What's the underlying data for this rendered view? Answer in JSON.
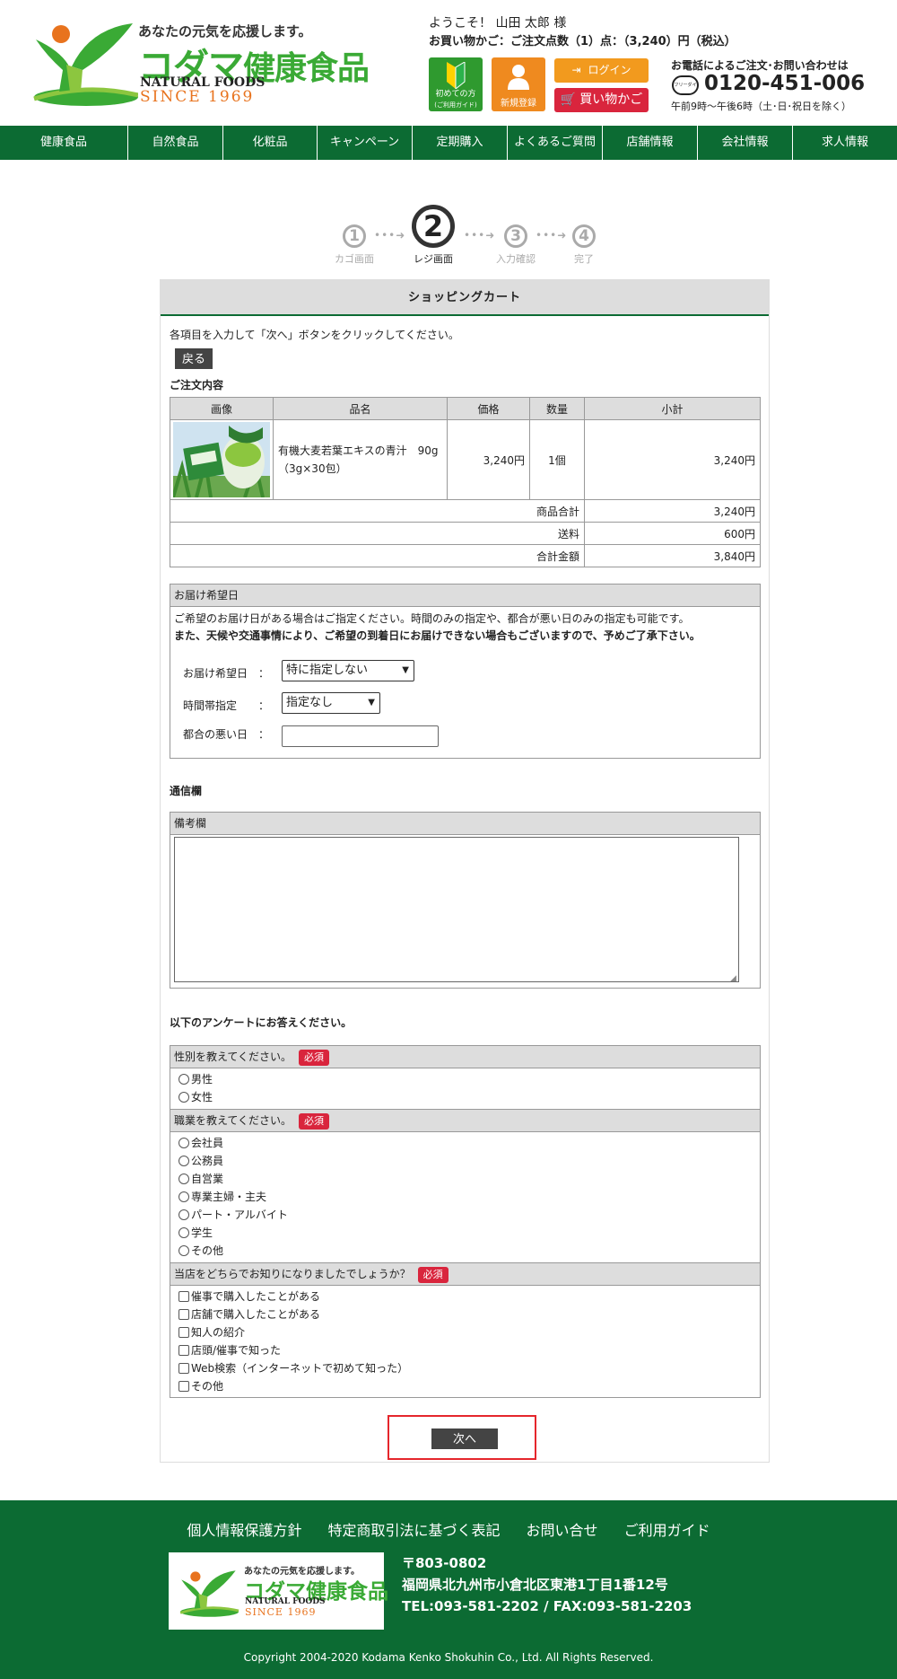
{
  "header": {
    "tagline": "あなたの元気を応援します。",
    "brand_kodama": "コダマ",
    "brand_kenko": "健康食品",
    "natural_foods": "NATURAL FOODS",
    "since": "SINCE  1969",
    "welcome": "ようこそ！ 山田 太郎 様",
    "cart_summary": "お買い物かご：ご注文点数（1）点：（3,240）円（税込）",
    "btn_first": "初めての方",
    "btn_first_sub": "(ご利用ガイド)",
    "btn_register": "新規登録",
    "btn_login": "ログイン",
    "btn_cart": "買い物かご",
    "tel_label": "お電話によるご注文･お問い合わせは",
    "tel_icon_text": "フリーダイヤル",
    "tel_number": "0120-451-006",
    "tel_hours": "午前9時〜午後6時（土･日･祝日を除く）",
    "colors": {
      "brand_green": "#3aaa35",
      "nav_green": "#0c6b33",
      "orange": "#ef8a1f",
      "red": "#d9253d"
    }
  },
  "nav": [
    "健康食品",
    "自然食品",
    "化粧品",
    "キャンペーン",
    "定期購入",
    "よくあるご質問",
    "店舗情報",
    "会社情報",
    "求人情報"
  ],
  "steps": [
    {
      "num": "1",
      "label": "カゴ画面"
    },
    {
      "num": "2",
      "label": "レジ画面"
    },
    {
      "num": "3",
      "label": "入力確認"
    },
    {
      "num": "4",
      "label": "完了"
    }
  ],
  "panel": {
    "title": "ショッピングカート",
    "intro": "各項目を入力して「次へ」ボタンをクリックしてください。",
    "back": "戻る",
    "order_title": "ご注文内容",
    "columns": [
      "画像",
      "品名",
      "価格",
      "数量",
      "小計"
    ],
    "item": {
      "name": "有機大麦若葉エキスの青汁　90g（3g×30包）",
      "price": "3,240円",
      "qty": "1個",
      "subtotal": "3,240円"
    },
    "totals": [
      {
        "label": "商品合計",
        "value": "3,240円"
      },
      {
        "label": "送料",
        "value": "600円"
      },
      {
        "label": "合計金額",
        "value": "3,840円"
      }
    ],
    "delivery": {
      "head": "お届け希望日",
      "note1": "ご希望のお届け日がある場合はご指定ください。時間のみの指定や、都合が悪い日のみの指定も可能です。",
      "note2": "また、天候や交通事情により、ご希望の到着日にお届けできない場合もございますので、予めご了承下さい。",
      "date_label": "お届け希望日　：",
      "date_value": "特に指定しない",
      "time_label": "時間帯指定　　：",
      "time_value": "指定なし",
      "ng_label": "都合の悪い日　："
    },
    "comm_title": "通信欄",
    "remarks_head": "備考欄",
    "survey_title": "以下のアンケートにお答えください。",
    "required": "必須",
    "q_gender": "性別を教えてください。",
    "gender_opts": [
      "男性",
      "女性"
    ],
    "q_job": "職業を教えてください。",
    "job_opts": [
      "会社員",
      "公務員",
      "自営業",
      "専業主婦・主夫",
      "パート・アルバイト",
      "学生",
      "その他"
    ],
    "q_source": "当店をどちらでお知りになりましたでしょうか？",
    "source_opts": [
      "催事で購入したことがある",
      "店舗で購入したことがある",
      "知人の紹介",
      "店頭/催事で知った",
      "Web検索（インターネットで初めて知った）",
      "その他"
    ],
    "next": "次へ"
  },
  "footer": {
    "links": [
      "個人情報保護方針",
      "特定商取引法に基づく表記",
      "お問い合せ",
      "ご利用ガイド"
    ],
    "zip": "〒803-0802",
    "address": "福岡県北九州市小倉北区東港1丁目1番12号",
    "tel_fax": "TEL:093-581-2202 / FAX:093-581-2203",
    "copyright": "Copyright 2004-2020 Kodama Kenko Shokuhin Co., Ltd. All Rights Reserved."
  }
}
